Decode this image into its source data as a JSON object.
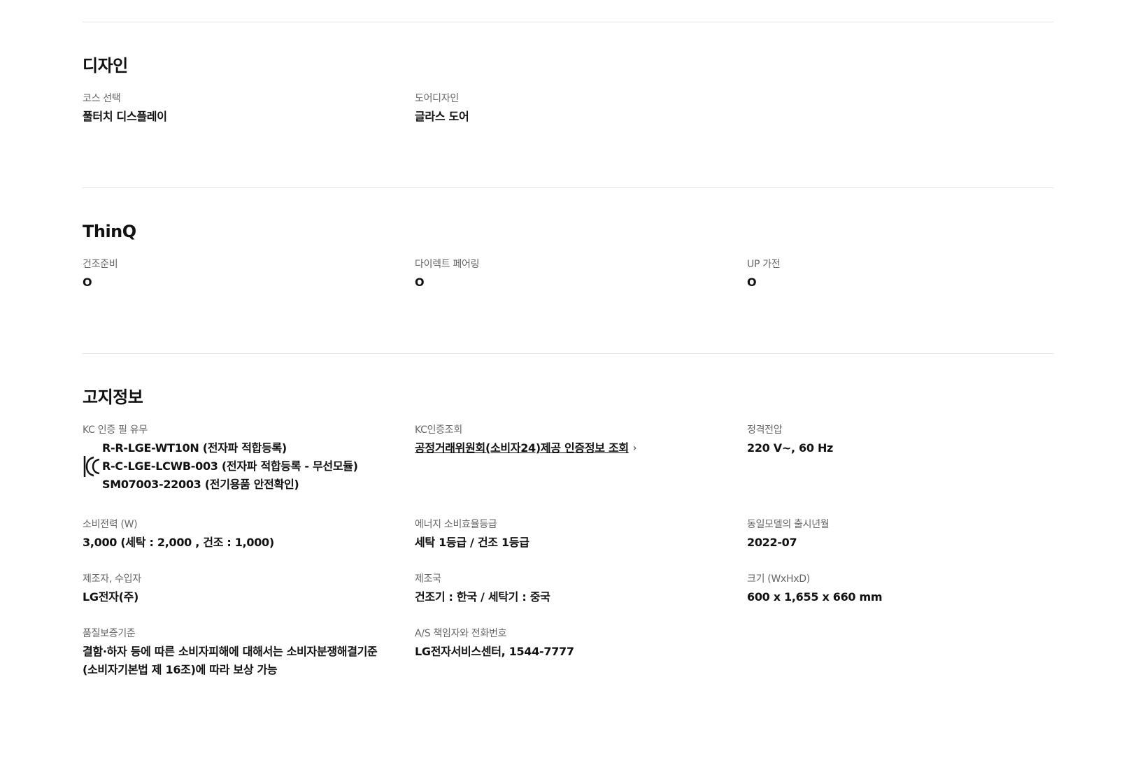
{
  "design": {
    "title": "디자인",
    "items": [
      {
        "label": "코스 선택",
        "value": "풀터치 디스플레이"
      },
      {
        "label": "도어디자인",
        "value": "글라스 도어"
      }
    ]
  },
  "thinq": {
    "title": "ThinQ",
    "items": [
      {
        "label": "건조준비",
        "value": "O"
      },
      {
        "label": "다이렉트 페어링",
        "value": "O"
      },
      {
        "label": "UP 가전",
        "value": "O"
      }
    ]
  },
  "notice": {
    "title": "고지정보",
    "kc": {
      "label": "KC 인증 필 유무",
      "icon": "kc-certification-mark-icon",
      "lines": [
        "R-R-LGE-WT10N (전자파 적합등록)",
        "R-C-LGE-LCWB-003 (전자파 적합등록 - 무선모듈)",
        "SM07003-22003 (전기용품 안전확인)"
      ]
    },
    "kc_lookup": {
      "label": "KC인증조회",
      "link_text": "공정거래위원회(소비자24)제공 인증정보 조회",
      "icon": "chevron-right-icon",
      "chevron": "›"
    },
    "voltage": {
      "label": "정격전압",
      "value": "220 V~, 60 Hz"
    },
    "power": {
      "label": "소비전력 (W)",
      "value": "3,000 (세탁 : 2,000 , 건조 : 1,000)"
    },
    "energy": {
      "label": "에너지 소비효율등급",
      "value": "세탁 1등급 / 건조 1등급"
    },
    "release": {
      "label": "동일모델의 출시년월",
      "value": "2022-07"
    },
    "maker": {
      "label": "제조자, 수입자",
      "value": "LG전자(주)"
    },
    "country": {
      "label": "제조국",
      "value": "건조기 : 한국 / 세탁기 : 중국"
    },
    "size": {
      "label": "크기 (WxHxD)",
      "value": "600 x 1,655 x 660 mm"
    },
    "warranty": {
      "label": "품질보증기준",
      "value_lines": [
        "결함·하자 등에 따른 소비자피해에 대해서는 소비자분쟁해결기준",
        "(소비자기본법 제 16조)에 따라 보상 가능"
      ]
    },
    "as": {
      "label": "A/S 책임자와 전화번호",
      "value": "LG전자서비스센터, 1544-7777"
    }
  }
}
